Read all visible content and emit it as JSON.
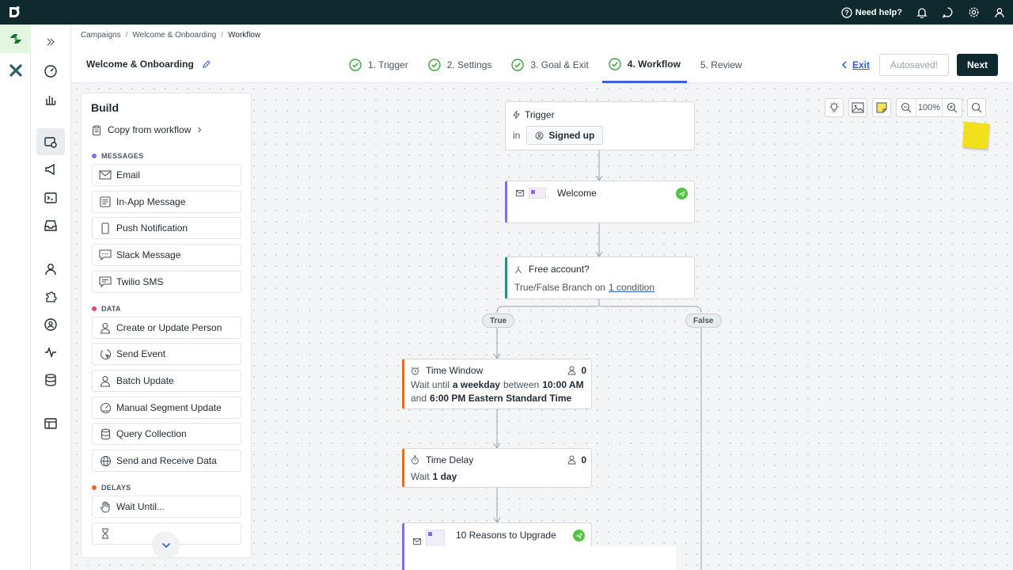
{
  "topbar": {
    "help_label": "Need help?"
  },
  "breadcrumb": {
    "items": [
      "Campaigns",
      "Welcome & Onboarding",
      "Workflow"
    ]
  },
  "header": {
    "title": "Welcome & Onboarding",
    "steps": [
      {
        "label": "1. Trigger",
        "done": true
      },
      {
        "label": "2. Settings",
        "done": true
      },
      {
        "label": "3. Goal & Exit",
        "done": true
      },
      {
        "label": "4. Workflow",
        "done": true,
        "active": true
      },
      {
        "label": "5. Review",
        "done": false
      }
    ],
    "exit_label": "Exit",
    "autosaved_label": "Autosaved!",
    "next_label": "Next"
  },
  "build": {
    "title": "Build",
    "copy_from": "Copy from workflow",
    "sections": {
      "messages": {
        "label": "MESSAGES",
        "color": "#8a6be0"
      },
      "data": {
        "label": "DATA",
        "color": "#e8407a"
      },
      "delays": {
        "label": "DELAYS",
        "color": "#e86a2b"
      }
    },
    "messages": [
      "Email",
      "In-App Message",
      "Push Notification",
      "Slack Message",
      "Twilio SMS"
    ],
    "data": [
      "Create or Update Person",
      "Send Event",
      "Batch Update",
      "Manual Segment Update",
      "Query Collection",
      "Send and Receive Data"
    ],
    "delays": [
      "Wait Until..."
    ]
  },
  "toolbar": {
    "zoom": "100%"
  },
  "workflow": {
    "trigger": {
      "title": "Trigger",
      "in_label": "in",
      "segment": "Signed up"
    },
    "welcome": {
      "title": "Welcome"
    },
    "branch": {
      "title": "Free account?",
      "desc_prefix": "True/False Branch on",
      "desc_link": "1 condition",
      "true_label": "True",
      "false_label": "False"
    },
    "time_window": {
      "title": "Time Window",
      "count": "0",
      "l1_a": "Wait until",
      "l1_b": "a weekday",
      "l1_c": "between",
      "l1_d": "10:00 AM",
      "l2_a": "and",
      "l2_b": "6:00 PM Eastern Standard Time"
    },
    "time_delay": {
      "title": "Time Delay",
      "count": "0",
      "l1_a": "Wait",
      "l1_b": "1 day"
    },
    "upgrade": {
      "title": "10 Reasons to Upgrade"
    }
  }
}
